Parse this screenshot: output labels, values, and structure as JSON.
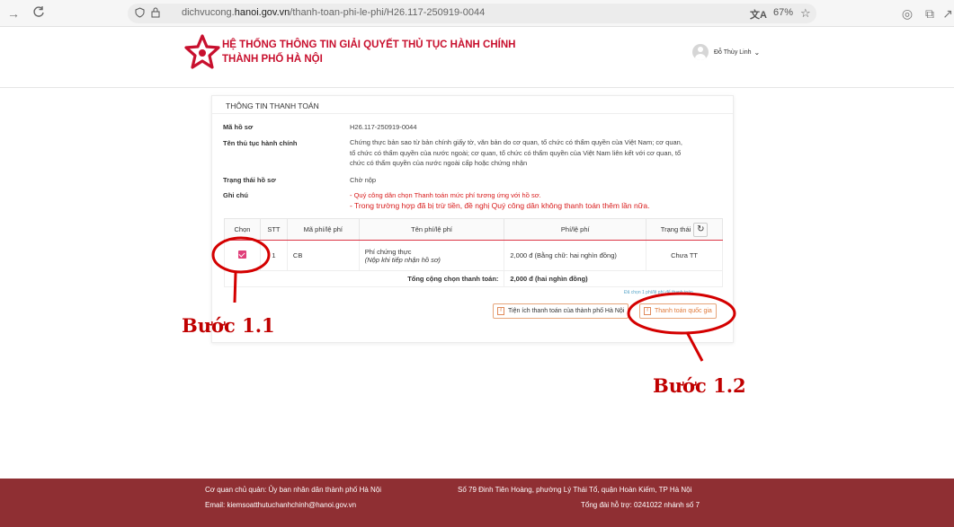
{
  "browser": {
    "url_prefix": "dichvucong.",
    "url_domain": "hanoi.gov.vn",
    "url_path": "/thanh-toan-phi-le-phi/H26.117-250919-0044",
    "zoom": "67%"
  },
  "header": {
    "title_line1": "HỆ THỐNG THÔNG TIN GIẢI QUYẾT THỦ TỤC HÀNH CHÍNH",
    "title_line2": "THÀNH PHỐ HÀ NỘI",
    "user_name": "Đỗ Thùy Linh"
  },
  "card": {
    "title": "THÔNG TIN THANH TOÁN",
    "fields": {
      "ma_ho_so_label": "Mã hồ sơ",
      "ma_ho_so_value": "H26.117-250919-0044",
      "ten_thu_tuc_label": "Tên thủ tục hành chính",
      "ten_thu_tuc_line1": "Chứng thực bản sao từ bản chính giấy tờ, văn bản do cơ quan, tổ chức có thẩm quyền của Việt Nam; cơ quan,",
      "ten_thu_tuc_line2": "tổ chức có thẩm quyền của nước ngoài; cơ quan, tổ chức có thẩm quyền của Việt Nam liên kết với cơ quan, tổ",
      "ten_thu_tuc_line3": "chức có thẩm quyền của nước ngoài cấp hoặc chứng nhận",
      "trang_thai_label": "Trạng thái hồ sơ",
      "trang_thai_value": "Chờ nộp",
      "ghi_chu_label": "Ghi chú",
      "note1": "- Quý công dân chọn Thanh toán mức phí tương ứng với hồ sơ.",
      "note2": "- Trong trường hợp đã bị trừ tiền, đề nghị Quý công dân không thanh toán thêm lần nữa."
    },
    "table": {
      "headers": {
        "chon": "Chọn",
        "stt": "STT",
        "ma_phi": "Mã phí/lệ phí",
        "ten_phi": "Tên phí/lệ phí",
        "phi": "Phí/lệ phí",
        "trang_thai": "Trạng thái"
      },
      "row": {
        "stt": "1",
        "ma_phi": "CB",
        "ten_phi": "Phí chứng thực",
        "ten_phi_note": "(Nộp khi tiếp nhận hồ sơ)",
        "phi": "2,000 đ (Bằng chữ: hai nghìn đồng)",
        "trang_thai": "Chưa TT"
      },
      "total_label": "Tổng cộng chọn thanh toán:",
      "total_value": "2,000 đ (hai nghìn đồng)"
    },
    "tiny_note": "Đã chọn 1 phí/lệ phí để thanh toán",
    "btn_city": "Tiện ích thanh toán của thành phố Hà Nội",
    "btn_national": "Thanh toán quốc gia"
  },
  "annotations": {
    "step1": "Bước 1.1",
    "step2": "Bước 1.2",
    "color": "#c00000"
  },
  "footer": {
    "co_quan": "Cơ quan chủ quản: Ủy ban nhân dân thành phố Hà Nội",
    "dia_chi": "Số 79 Đinh Tiên Hoàng, phường Lý Thái Tổ, quận Hoàn Kiếm, TP Hà Nội",
    "email": "Email: kiemsoatthutuchanhchinh@hanoi.gov.vn",
    "hotline": "Tổng đài hỗ trợ: 0241022 nhánh số 7"
  },
  "colors": {
    "brand_red": "#c8102e",
    "footer_bg": "#8f2f33",
    "checkbox": "#e0407a"
  }
}
